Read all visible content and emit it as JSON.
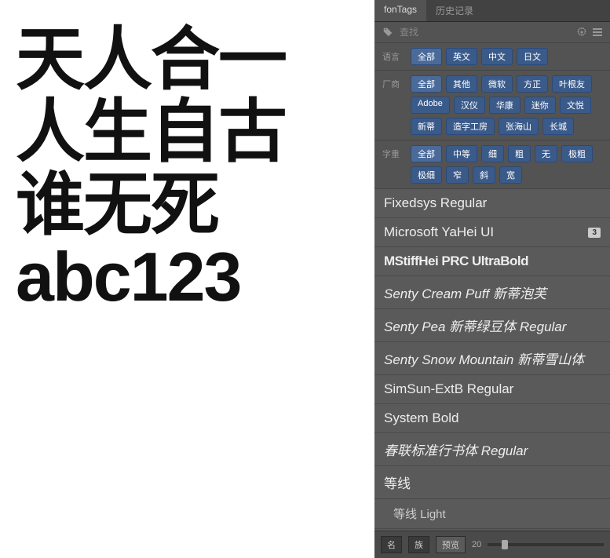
{
  "preview": {
    "text": "天人合一\n人生自古\n谁无死\nabc123"
  },
  "tabs": [
    {
      "label": "fonTags",
      "active": true
    },
    {
      "label": "历史记录",
      "active": false
    }
  ],
  "search": {
    "placeholder": "查找"
  },
  "filters": {
    "language": {
      "label": "语言",
      "pills": [
        "全部",
        "英文",
        "中文",
        "日文"
      ]
    },
    "vendor": {
      "label": "厂商",
      "pills": [
        "全部",
        "其他",
        "微软",
        "方正",
        "叶根友",
        "Adobe",
        "汉仪",
        "华康",
        "迷你",
        "文悦",
        "新蒂",
        "造字工房",
        "张海山",
        "长城"
      ]
    },
    "weight": {
      "label": "字重",
      "pills": [
        "全部",
        "中等",
        "细",
        "粗",
        "无",
        "极粗",
        "极细",
        "窄",
        "斜",
        "宽"
      ]
    }
  },
  "fonts": [
    {
      "name": "Fixedsys Regular",
      "style": "f-serif"
    },
    {
      "name": "Microsoft YaHei UI",
      "style": "",
      "badge": "3"
    },
    {
      "name": "MStiffHei PRC UltraBold",
      "style": "f-bold"
    },
    {
      "name": "Senty Cream Puff 新蒂泡芙",
      "style": "f-script"
    },
    {
      "name": "Senty Pea 新蒂绿豆体 Regular",
      "style": "f-script"
    },
    {
      "name": "Senty Snow Mountain 新蒂雪山体",
      "style": "f-script"
    },
    {
      "name": "SimSun-ExtB Regular",
      "style": "f-mono"
    },
    {
      "name": "System Bold",
      "style": "f-serif"
    },
    {
      "name": "春联标准行书体 Regular",
      "style": "f-script"
    },
    {
      "name": "等线",
      "style": ""
    },
    {
      "name": "等线 Light",
      "style": "",
      "child": true
    }
  ],
  "bottom": {
    "btn1": "名",
    "btn2": "族",
    "btn3": "预览",
    "size": "20"
  }
}
